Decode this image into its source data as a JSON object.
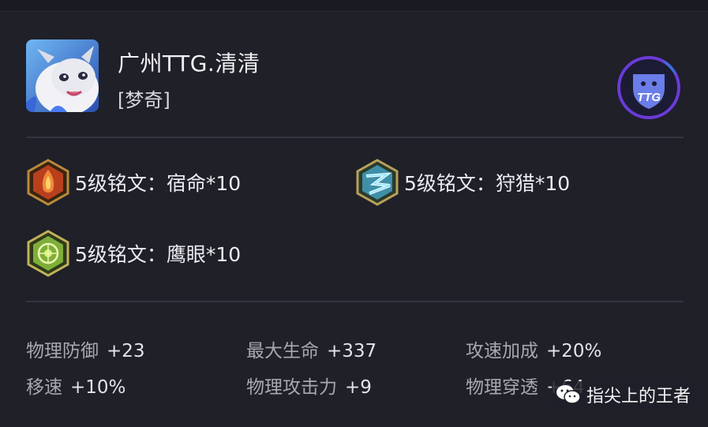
{
  "player": {
    "name": "广州TTG.清清",
    "hero": "[梦奇]",
    "avatar_icon": "hero-portrait-mengqi",
    "team_logo": "TTG"
  },
  "runes": [
    {
      "icon": "rune-red-hexagon-icon",
      "label": "5级铭文：宿命*10"
    },
    {
      "icon": "rune-blue-hexagon-icon",
      "label": "5级铭文：狩猎*10"
    },
    {
      "icon": "rune-green-hexagon-icon",
      "label": "5级铭文：鹰眼*10"
    }
  ],
  "stats": [
    {
      "key": "物理防御",
      "value": "+23"
    },
    {
      "key": "最大生命",
      "value": "+337"
    },
    {
      "key": "攻速加成",
      "value": "+20%"
    },
    {
      "key": "移速",
      "value": "+10%"
    },
    {
      "key": "物理攻击力",
      "value": "+9"
    },
    {
      "key": "物理穿透",
      "value": "+64"
    }
  ],
  "watermark": {
    "text": "指尖上的王者",
    "icon": "wechat-icon"
  },
  "colors": {
    "background": "#1f2028",
    "divider": "#33343f",
    "label": "#a7a8b0",
    "value": "#e4e4e8",
    "team_purple": "#6b3bd6"
  }
}
